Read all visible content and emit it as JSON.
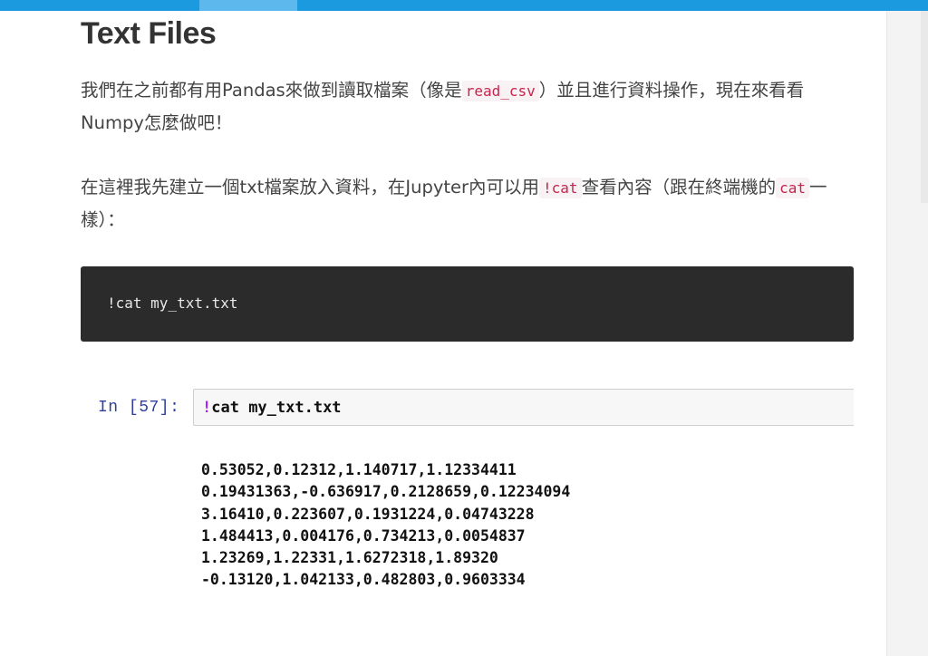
{
  "article": {
    "title": "Text Files",
    "para1": {
      "before": "我們在之前都有用Pandas來做到讀取檔案（像是",
      "code": "read_csv",
      "after": "）並且進行資料操作，現在來看看Numpy怎麼做吧！"
    },
    "para2": {
      "before": "在這裡我先建立一個txt檔案放入資料，在Jupyter內可以用",
      "code1": "!cat",
      "middle": "查看內容（跟在終端機的",
      "code2": "cat",
      "after": "一樣）："
    },
    "code_block": "!cat my_txt.txt"
  },
  "notebook": {
    "prompt": "In [57]:",
    "input": {
      "bang": "!",
      "rest": "cat my_txt.txt"
    },
    "output_lines": [
      "0.53052,0.12312,1.140717,1.12334411",
      "0.19431363,-0.636917,0.2128659,0.12234094",
      "3.16410,0.223607,0.1931224,0.04743228",
      "1.484413,0.004176,0.734213,0.0054837",
      "1.23269,1.22331,1.6272318,1.89320",
      "-0.13120,1.042133,0.482803,0.9603334"
    ]
  },
  "colors": {
    "top_bar": "#1b9ae0",
    "inline_code": "#c7254e",
    "prompt": "#303f9f",
    "code_block_bg": "#2b2b2b"
  }
}
